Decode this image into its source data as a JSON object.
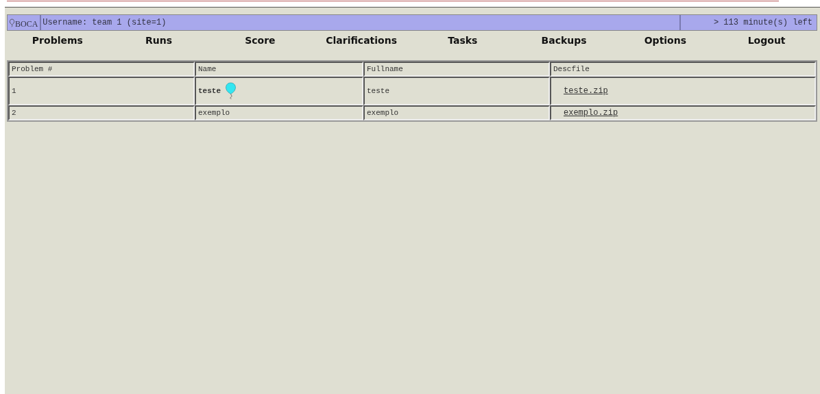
{
  "header": {
    "logo": "BOCA",
    "user": "Username: team 1 (site=1)",
    "time_left": "> 113 minute(s) left"
  },
  "menu": [
    "Problems",
    "Runs",
    "Score",
    "Clarifications",
    "Tasks",
    "Backups",
    "Options",
    "Logout"
  ],
  "table": {
    "columns": [
      "Problem #",
      "Name",
      "Fullname",
      "Descfile"
    ],
    "rows": [
      {
        "number": "1",
        "name": "teste",
        "balloon": {
          "color": "#33e6f0"
        },
        "fullname": "teste",
        "descfile": "teste.zip"
      },
      {
        "number": "2",
        "name": "exemplo",
        "fullname": "exemplo",
        "descfile": "exemplo.zip"
      }
    ]
  }
}
